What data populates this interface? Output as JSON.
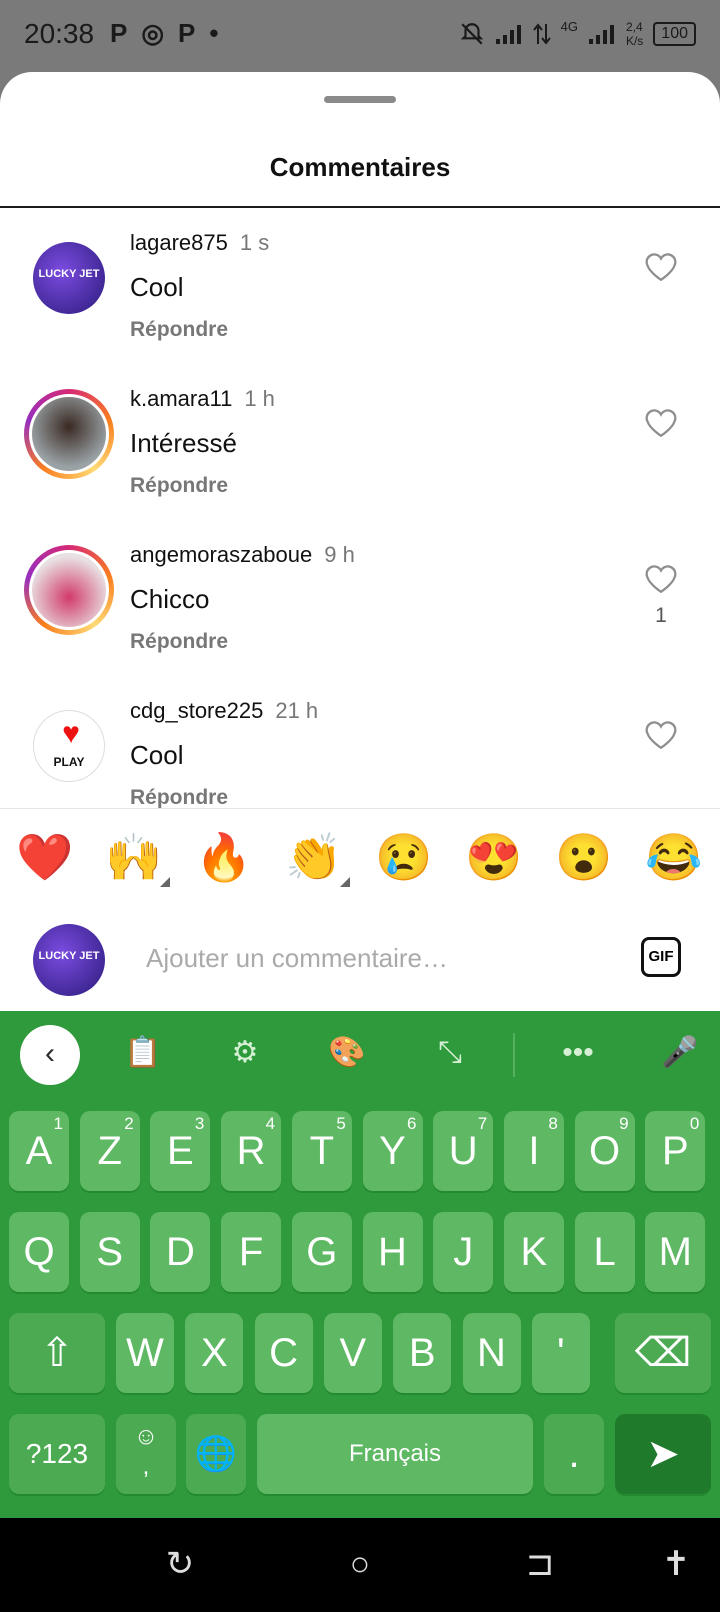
{
  "status_bar": {
    "time": "20:38",
    "left_icons": [
      "P",
      "◎",
      "P",
      "•"
    ],
    "network_type": "4G",
    "speed_value": "2,4",
    "speed_unit": "K/s",
    "battery": "100"
  },
  "sheet": {
    "title": "Commentaires"
  },
  "comments": [
    {
      "username": "lagare875",
      "time": "1 s",
      "text": "Cool",
      "reply_label": "Répondre",
      "likes": "",
      "avatar_text": "LUCKY JET"
    },
    {
      "username": "k.amara11",
      "time": "1 h",
      "text": "Intéressé",
      "reply_label": "Répondre",
      "likes": ""
    },
    {
      "username": "angemoraszaboue",
      "time": "9 h",
      "text": "Chicco",
      "reply_label": "Répondre",
      "likes": "1"
    },
    {
      "username": "cdg_store225",
      "time": "21 h",
      "text": "Cool",
      "reply_label": "Répondre",
      "likes": "",
      "avatar_text": "PLAY"
    }
  ],
  "emoji_bar": [
    "❤️",
    "🙌",
    "🔥",
    "👏",
    "😢",
    "😍",
    "😮",
    "😂"
  ],
  "comment_input": {
    "placeholder": "Ajouter un commentaire…",
    "gif_label": "GIF",
    "avatar_text": "LUCKY JET"
  },
  "keyboard": {
    "row1": [
      {
        "k": "A",
        "h": "1"
      },
      {
        "k": "Z",
        "h": "2"
      },
      {
        "k": "E",
        "h": "3"
      },
      {
        "k": "R",
        "h": "4"
      },
      {
        "k": "T",
        "h": "5"
      },
      {
        "k": "Y",
        "h": "6"
      },
      {
        "k": "U",
        "h": "7"
      },
      {
        "k": "I",
        "h": "8"
      },
      {
        "k": "O",
        "h": "9"
      },
      {
        "k": "P",
        "h": "0"
      }
    ],
    "row2": [
      "Q",
      "S",
      "D",
      "F",
      "G",
      "H",
      "J",
      "K",
      "L",
      "M"
    ],
    "row3": [
      "W",
      "X",
      "C",
      "V",
      "B",
      "N",
      "'"
    ],
    "symbols_label": "?123",
    "comma_label": ",",
    "space_label": "Français",
    "period_label": "."
  },
  "colors": {
    "keyboard_bg": "#2f9a3c",
    "key_bg": "#5fb864",
    "send_key": "#1f7a2c"
  }
}
